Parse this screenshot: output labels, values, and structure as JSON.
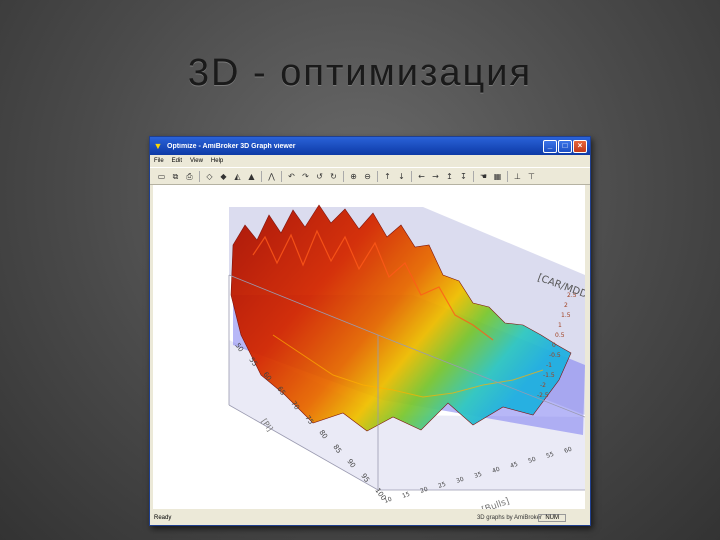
{
  "slide": {
    "title": "3D - оптимизация"
  },
  "window": {
    "title": "Optimize - AmiBroker 3D Graph viewer",
    "menu": [
      "File",
      "Edit",
      "View",
      "Help"
    ],
    "buttons": {
      "minimize": "_",
      "maximize": "□",
      "close": "×"
    }
  },
  "graph": {
    "axis_x_label": "[Bulls]",
    "axis_y_label": "[Pl]",
    "axis_z_label": "[CAR/MDD]",
    "y_ticks": [
      "100",
      "95",
      "90",
      "85",
      "80",
      "75",
      "70",
      "65",
      "60",
      "55",
      "50"
    ],
    "x_ticks": [
      "10",
      "15",
      "20",
      "25",
      "30",
      "35",
      "40",
      "45",
      "50",
      "55",
      "60"
    ],
    "z_ticks": [
      "2.5",
      "2",
      "1.5",
      "1",
      "0.5",
      "0",
      "-0.5",
      "-1",
      "-1.5",
      "-2",
      "-2.5"
    ],
    "credit": "3D graphs by AmiBroker"
  },
  "status": {
    "left": "Ready",
    "right": "NUM"
  },
  "colors": {
    "surface_high": "#c41a00",
    "surface_mid": "#f0a000",
    "surface_low": "#30c8c0",
    "plane": "#7b7bf0"
  }
}
